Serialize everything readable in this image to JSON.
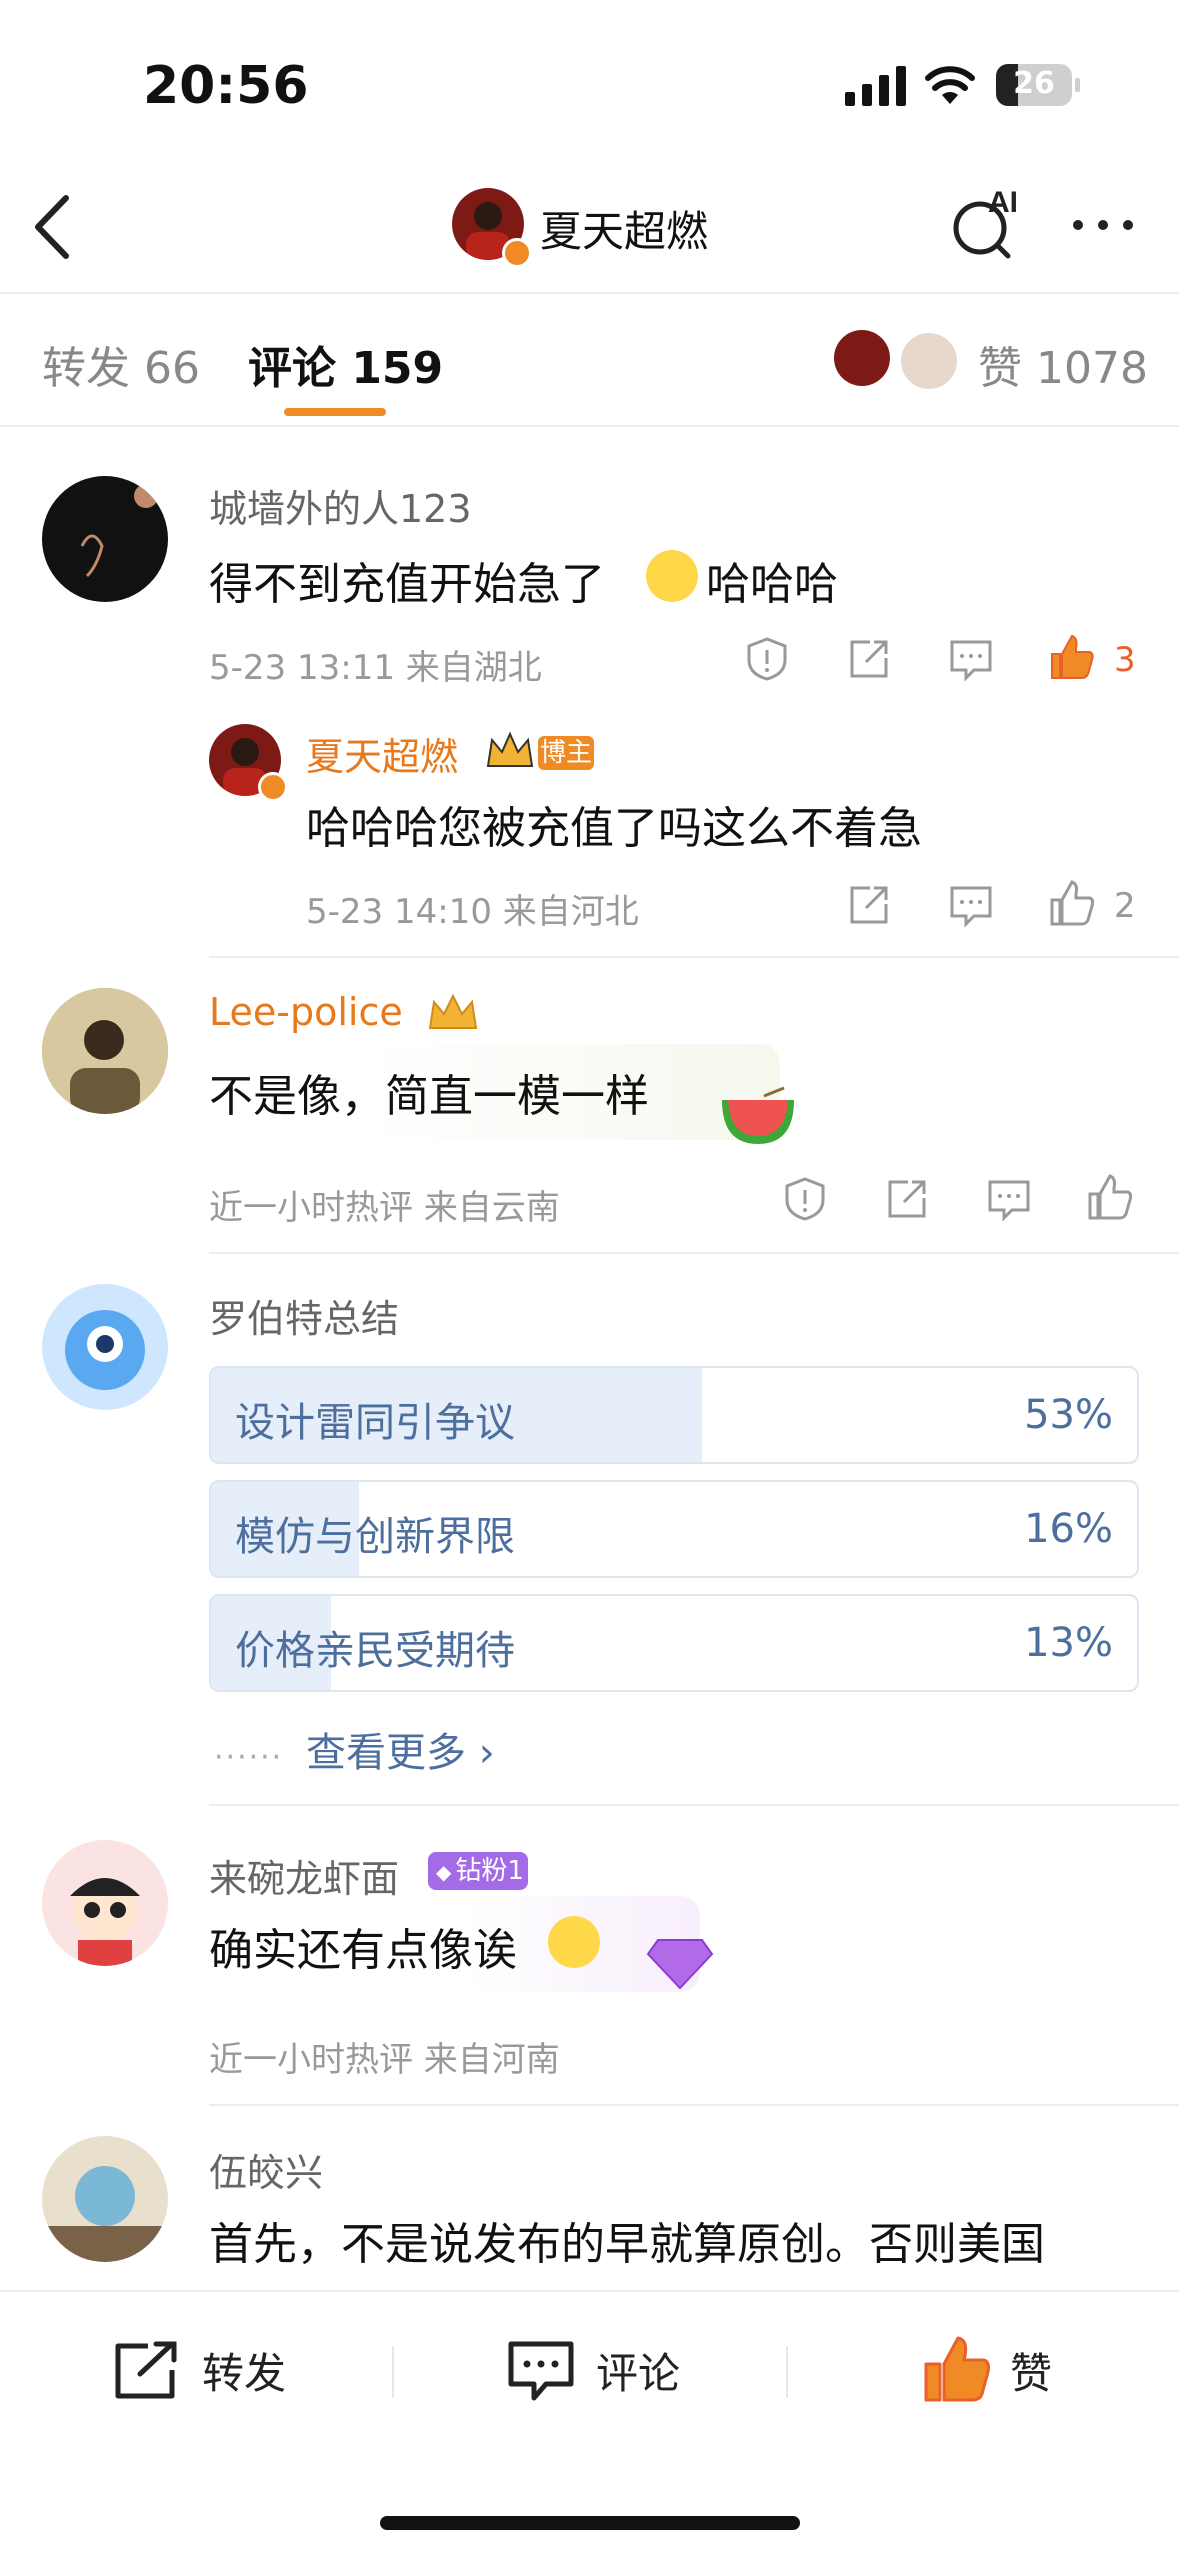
{
  "status": {
    "time": "20:56",
    "battery": "26"
  },
  "nav": {
    "title": "夏天超燃",
    "ai_label": "AI"
  },
  "tabs": {
    "forward": "转发 66",
    "comment": "评论 159",
    "like": "赞 1078"
  },
  "comments": [
    {
      "user": "城墙外的人123",
      "text": "得不到充值开始急了",
      "text_suffix": "哈哈哈",
      "meta": "5-23 13:11  来自湖北",
      "likes": "3",
      "reply": {
        "user": "夏天超燃",
        "badge": "博主",
        "text": "哈哈哈您被充值了吗这么不着急",
        "meta": "5-23 14:10  来自河北",
        "likes": "2"
      }
    },
    {
      "user": "Lee-police",
      "text": "不是像，简直一模一样",
      "meta": "近一小时热评  来自云南"
    },
    {
      "user": "罗伯特总结",
      "poll": [
        {
          "label": "设计雷同引争议",
          "pct": "53%",
          "value": 53
        },
        {
          "label": "模仿与创新界限",
          "pct": "16%",
          "value": 16
        },
        {
          "label": "价格亲民受期待",
          "pct": "13%",
          "value": 13
        }
      ],
      "see_more": "查看更多 ›"
    },
    {
      "user": "来碗龙虾面",
      "badge": "钻粉1",
      "text": "确实还有点像诶",
      "meta": "近一小时热评  来自河南"
    },
    {
      "user": "伍皎兴",
      "text": "首先，不是说发布的早就算原创。否则美国"
    }
  ],
  "bottom": {
    "forward": "转发",
    "comment": "评论",
    "like": "赞"
  }
}
